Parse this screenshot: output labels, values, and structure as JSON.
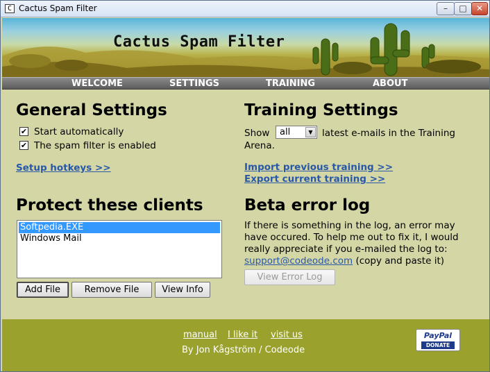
{
  "window": {
    "title": "Cactus Spam Filter",
    "icon_char": "C",
    "minimize_glyph": "–",
    "maximize_glyph": "□",
    "close_glyph": "✕"
  },
  "banner": {
    "title": "Cactus Spam Filter"
  },
  "nav": {
    "items": [
      "WELCOME",
      "SETTINGS",
      "TRAINING",
      "ABOUT"
    ]
  },
  "general": {
    "heading": "General Settings",
    "checkbox_start": {
      "label": "Start automatically",
      "checked": true,
      "glyph": "✔"
    },
    "checkbox_enabled": {
      "label": "The spam filter is enabled",
      "checked": true,
      "glyph": "✔"
    },
    "setup_hotkeys": "Setup hotkeys >>"
  },
  "training": {
    "heading": "Training Settings",
    "show_label": "Show",
    "show_value": "all",
    "after_text": "latest e-mails in the Training",
    "after_text2": "Arena.",
    "import_link": "Import previous training >>",
    "export_link": "Export current training >>"
  },
  "clients": {
    "heading": "Protect these clients",
    "items": [
      "Softpedia.EXE",
      "Windows Mail"
    ],
    "selected_index": 0,
    "add_button": "Add File",
    "remove_button": "Remove File",
    "view_button": "View Info"
  },
  "beta": {
    "heading": "Beta error log",
    "line1": "If there is something in the log, an error may",
    "line2": "have occured. To help me out to fix it, I would",
    "line3": "really appreciate if you e-mailed the log to:",
    "email": "support@codeode.com",
    "email_suffix": " (copy and paste it)",
    "view_log_button": "View Error Log"
  },
  "footer": {
    "links": [
      "manual",
      "I like it",
      "visit us"
    ],
    "credit": "By Jon Kågström / Codeode",
    "paypal_word": "PayPal",
    "paypal_donate": "DONATE"
  },
  "colors": {
    "background": "#d4d6a6",
    "footer": "#9aa12c",
    "link": "#2858a8",
    "nav": "#6a6a6a"
  }
}
